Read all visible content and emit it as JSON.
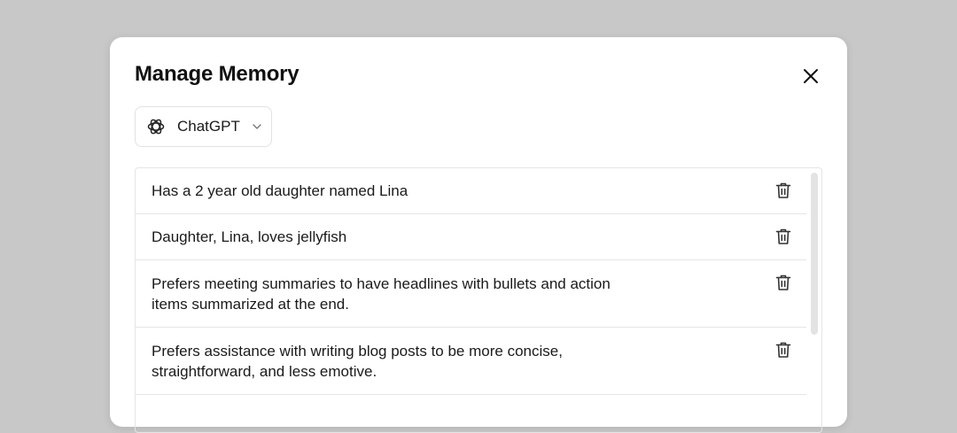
{
  "modal": {
    "title": "Manage Memory",
    "close_icon": "close-icon"
  },
  "selector": {
    "label": "ChatGPT",
    "logo_icon": "openai-logo-icon",
    "chevron_icon": "chevron-down-icon"
  },
  "memories": [
    {
      "text": "Has a 2 year old daughter named Lina"
    },
    {
      "text": "Daughter, Lina, loves jellyfish"
    },
    {
      "text": "Prefers meeting summaries to have headlines with bullets and action items summarized at the end."
    },
    {
      "text": "Prefers assistance with writing blog posts to be more concise, straightforward, and less emotive."
    }
  ],
  "colors": {
    "backdrop": "#c8c8c8",
    "modal_bg": "#ffffff",
    "text": "#1a1a1a",
    "border": "#e5e5e5"
  }
}
